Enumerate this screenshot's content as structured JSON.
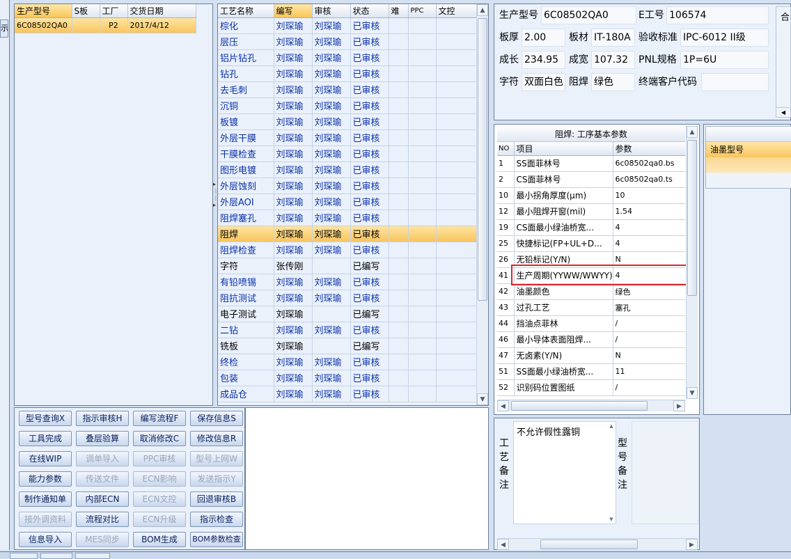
{
  "left_stub_text": "示",
  "orders": {
    "columns": [
      "生产型号",
      "S板",
      "工厂",
      "交货日期"
    ],
    "rows": [
      [
        "6C08502QA0",
        "",
        "P2",
        "2017/4/12"
      ]
    ]
  },
  "process": {
    "columns": [
      "工艺名称",
      "编写",
      "审核",
      "状态",
      "难",
      "PPC",
      "文控"
    ],
    "rows": [
      [
        "棕化",
        "刘琛瑜",
        "刘琛瑜",
        "已审核"
      ],
      [
        "层压",
        "刘琛瑜",
        "刘琛瑜",
        "已审核"
      ],
      [
        "铝片钻孔",
        "刘琛瑜",
        "刘琛瑜",
        "已审核"
      ],
      [
        "钻孔",
        "刘琛瑜",
        "刘琛瑜",
        "已审核"
      ],
      [
        "去毛刺",
        "刘琛瑜",
        "刘琛瑜",
        "已审核"
      ],
      [
        "沉铜",
        "刘琛瑜",
        "刘琛瑜",
        "已审核"
      ],
      [
        "板镀",
        "刘琛瑜",
        "刘琛瑜",
        "已审核"
      ],
      [
        "外层干膜",
        "刘琛瑜",
        "刘琛瑜",
        "已审核"
      ],
      [
        "干膜检查",
        "刘琛瑜",
        "刘琛瑜",
        "已审核"
      ],
      [
        "图形电镀",
        "刘琛瑜",
        "刘琛瑜",
        "已审核"
      ],
      [
        "外层蚀刻",
        "刘琛瑜",
        "刘琛瑜",
        "已审核"
      ],
      [
        "外层AOI",
        "刘琛瑜",
        "刘琛瑜",
        "已审核"
      ],
      [
        "阻焊塞孔",
        "刘琛瑜",
        "刘琛瑜",
        "已审核"
      ],
      [
        "阻焊",
        "刘琛瑜",
        "刘琛瑜",
        "已审核"
      ],
      [
        "阻焊检查",
        "刘琛瑜",
        "刘琛瑜",
        "已审核"
      ],
      [
        "字符",
        "张传刚",
        "",
        "已编写"
      ],
      [
        "有铅喷锡",
        "刘琛瑜",
        "刘琛瑜",
        "已审核"
      ],
      [
        "阻抗测试",
        "刘琛瑜",
        "刘琛瑜",
        "已审核"
      ],
      [
        "电子测试",
        "刘琛瑜",
        "",
        "已编写"
      ],
      [
        "二钻",
        "刘琛瑜",
        "刘琛瑜",
        "已审核"
      ],
      [
        "铣板",
        "刘琛瑜",
        "",
        "已编写"
      ],
      [
        "终检",
        "刘琛瑜",
        "刘琛瑜",
        "已审核"
      ],
      [
        "包装",
        "刘琛瑜",
        "刘琛瑜",
        "已审核"
      ],
      [
        "成品仓",
        "刘琛瑜",
        "刘琛瑜",
        "已审核"
      ]
    ]
  },
  "buttons": [
    [
      "型号查询X",
      "指示审核H",
      "编写流程F",
      "保存信息S"
    ],
    [
      "工具完成",
      "叠层验算",
      "取消修改C",
      "修改信息R"
    ],
    [
      "在线WIP",
      "调单导入",
      "PPC审核",
      "型号上网W"
    ],
    [
      "能力参数",
      "传送文件",
      "ECN影响",
      "发送指示Y"
    ],
    [
      "制作通知单",
      "内部ECN",
      "ECN文控",
      "回退审核B"
    ],
    [
      "接外调资料",
      "流程对比",
      "ECN升级",
      "指示检查"
    ],
    [
      "信息导入",
      "MES同步",
      "BOM生成",
      "BOM参数检查"
    ]
  ],
  "info": {
    "model_label": "生产型号",
    "model_value": "6C08502QA0",
    "eng_label": "E工号",
    "eng_value": "106574",
    "thick_label": "板厚",
    "thick_value": "2.00",
    "mat_label": "板材",
    "mat_value": "IT-180A",
    "std_label": "验收标准",
    "std_value": "IPC-6012 II级",
    "len_label": "成长",
    "len_value": "234.95",
    "wid_label": "成宽",
    "wid_value": "107.32",
    "pnl_label": "PNL规格",
    "pnl_value": "1P=6U",
    "char_label": "字符",
    "char_value": "双面白色",
    "mask_label": "阻焊",
    "mask_value": "绿色",
    "cust_label": "终端客户代码",
    "cust_value": "",
    "right_stub_label": "合"
  },
  "params": {
    "title": "阻焊: 工序基本参数",
    "columns": [
      "NO",
      "项目",
      "参数"
    ],
    "rows": [
      [
        "1",
        "SS面菲林号",
        "6c08502qa0.bs"
      ],
      [
        "2",
        "CS面菲林号",
        "6c08502qa0.ts"
      ],
      [
        "10",
        "最小拐角厚度(μm)",
        "10"
      ],
      [
        "12",
        "最小阻焊开窗(mil)",
        "1.54"
      ],
      [
        "19",
        "CS面最小绿油桥宽...",
        "4"
      ],
      [
        "25",
        "快捷标记(FP+UL+D...",
        "4"
      ],
      [
        "26",
        "无铅标记(Y/N)",
        "N"
      ],
      [
        "41",
        "生产周期(YYWW/WWYY)",
        "4"
      ],
      [
        "42",
        "油墨颜色",
        "绿色"
      ],
      [
        "43",
        "过孔工艺",
        "塞孔"
      ],
      [
        "44",
        "挡油点菲林",
        "/"
      ],
      [
        "46",
        "最小导体表面阻焊...",
        "/"
      ],
      [
        "47",
        "无卤素(Y/N)",
        "N"
      ],
      [
        "51",
        "SS面最小绿油桥宽...",
        "11"
      ],
      [
        "52",
        "识别码位置图纸",
        "/"
      ]
    ]
  },
  "ink": {
    "header": "油墨型号"
  },
  "notes": {
    "craft_label": "工艺备注",
    "craft_text": "不允许假性露铜",
    "model_label": "型号备注"
  },
  "colors": {
    "selected": "#fbd07a",
    "highlight_border": "#d9262a"
  }
}
